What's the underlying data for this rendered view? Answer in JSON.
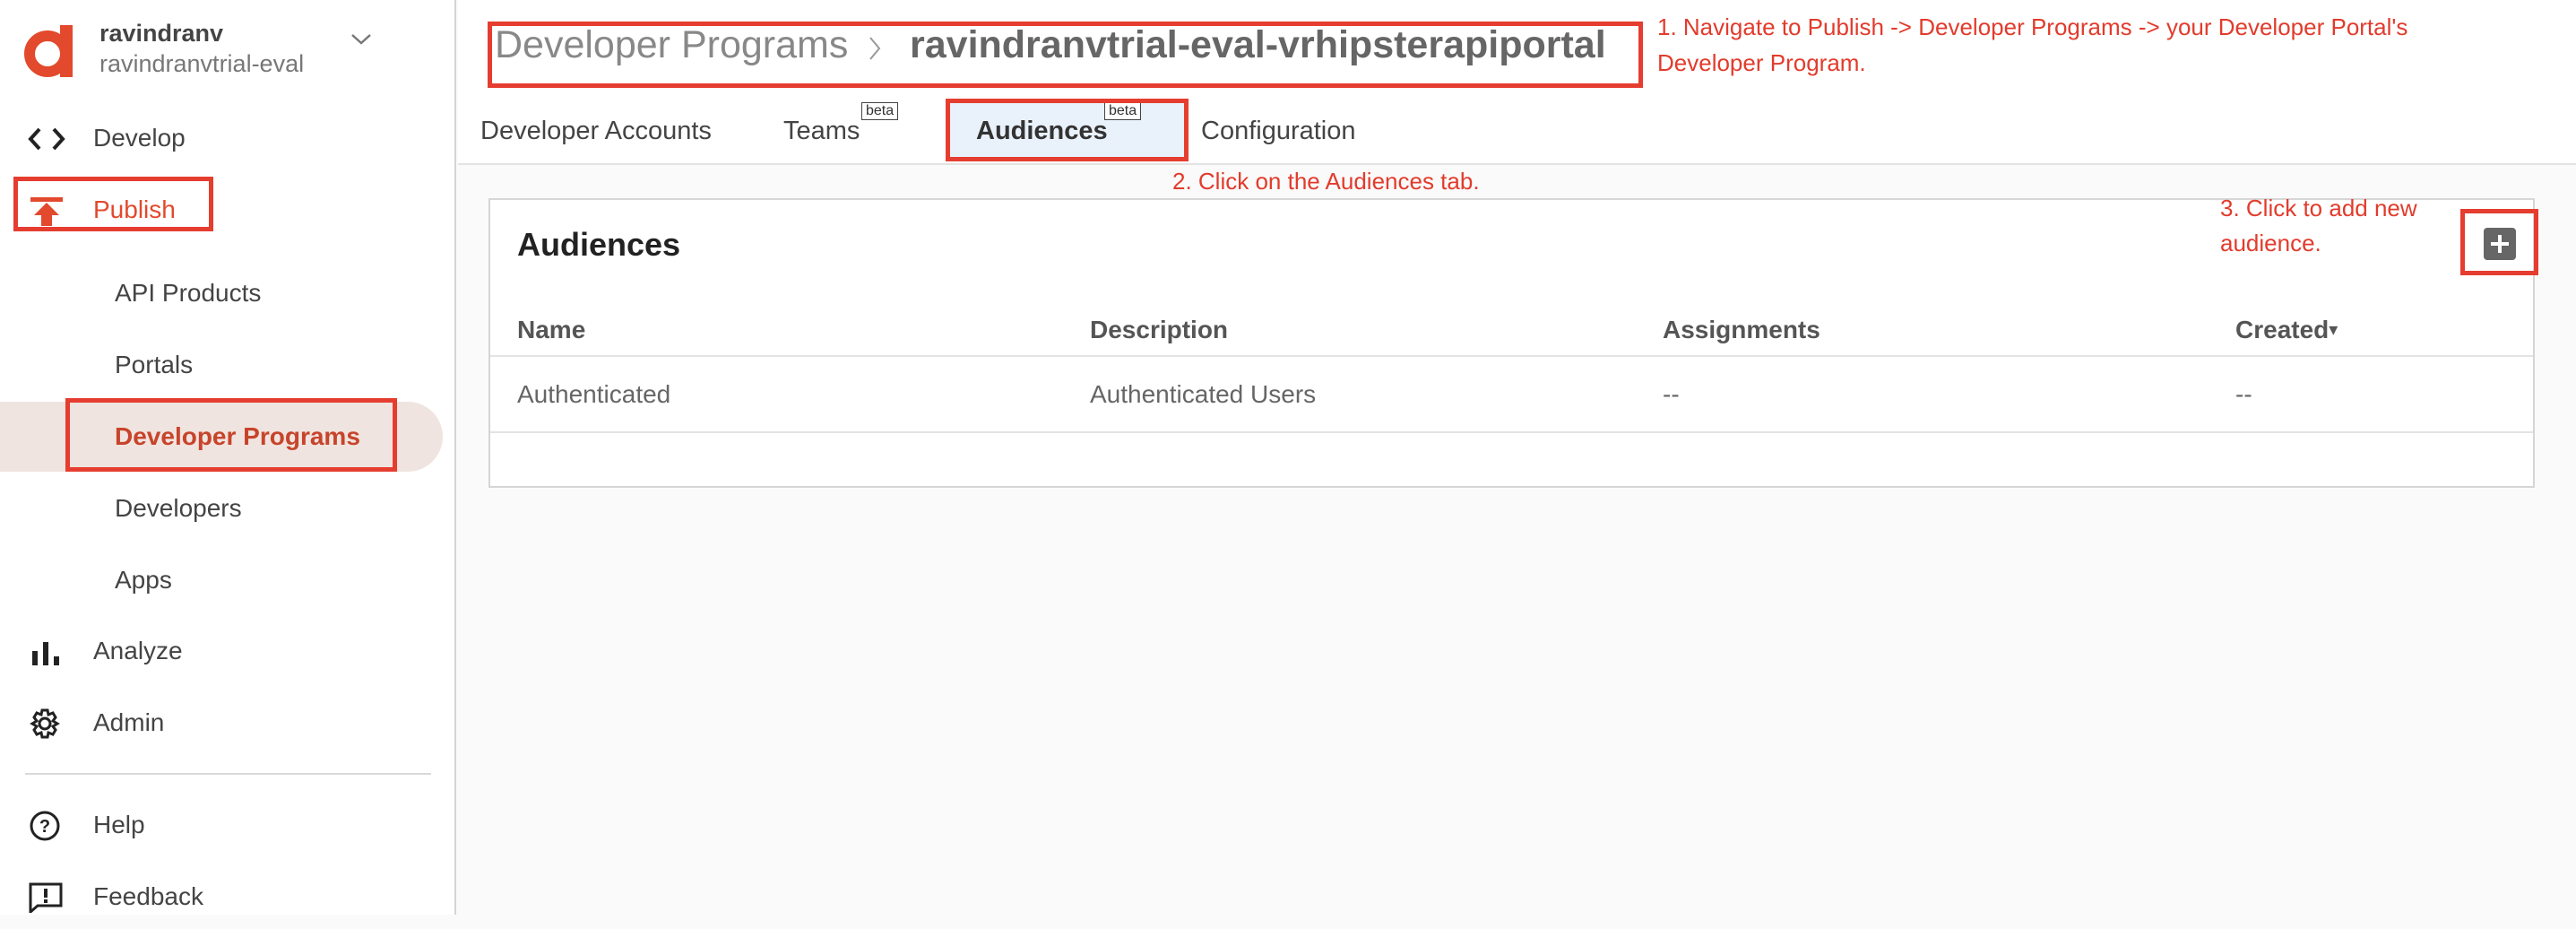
{
  "sidebar": {
    "org_user": "ravindranv",
    "org_name": "ravindranvtrial-eval",
    "nav": {
      "develop": "Develop",
      "publish": "Publish",
      "analyze": "Analyze",
      "admin": "Admin",
      "help": "Help",
      "feedback": "Feedback"
    },
    "publish_items": [
      "API Products",
      "Portals",
      "Developer Programs",
      "Developers",
      "Apps"
    ],
    "selected_item": "Developer Programs"
  },
  "header": {
    "breadcrumb_parent": "Developer Programs",
    "breadcrumb_current": "ravindranvtrial-eval-vrhipsterapiportal"
  },
  "tabs": [
    {
      "label": "Developer Accounts"
    },
    {
      "label": "Teams",
      "badge": "beta"
    },
    {
      "label": "Audiences",
      "badge": "beta",
      "active": true
    },
    {
      "label": "Configuration"
    }
  ],
  "card": {
    "title": "Audiences",
    "columns": [
      "Name",
      "Description",
      "Assignments",
      "Created"
    ],
    "sort_indicator": "▾",
    "rows": [
      {
        "name": "Authenticated",
        "description": "Authenticated Users",
        "assignments": "--",
        "created": "--"
      }
    ]
  },
  "annotations": {
    "step1_line1": "1. Navigate to Publish -> Developer Programs -> your Developer Portal's",
    "step1_line2": "Developer Program.",
    "step2": "2. Click on the Audiences tab.",
    "step3_line1": "3. Click to add new",
    "step3_line2": "audience."
  },
  "colors": {
    "accent": "#e2492d",
    "annotation": "#e53d2f",
    "selected_bg": "#f0e4e0",
    "active_tab_bg": "#e9f1fb"
  },
  "icons": [
    "apigee-logo-icon",
    "chevron-down-icon",
    "code-icon",
    "publish-upload-icon",
    "analytics-bar-icon",
    "gear-icon",
    "help-circle-icon",
    "feedback-icon",
    "chevron-right-icon",
    "plus-icon"
  ]
}
